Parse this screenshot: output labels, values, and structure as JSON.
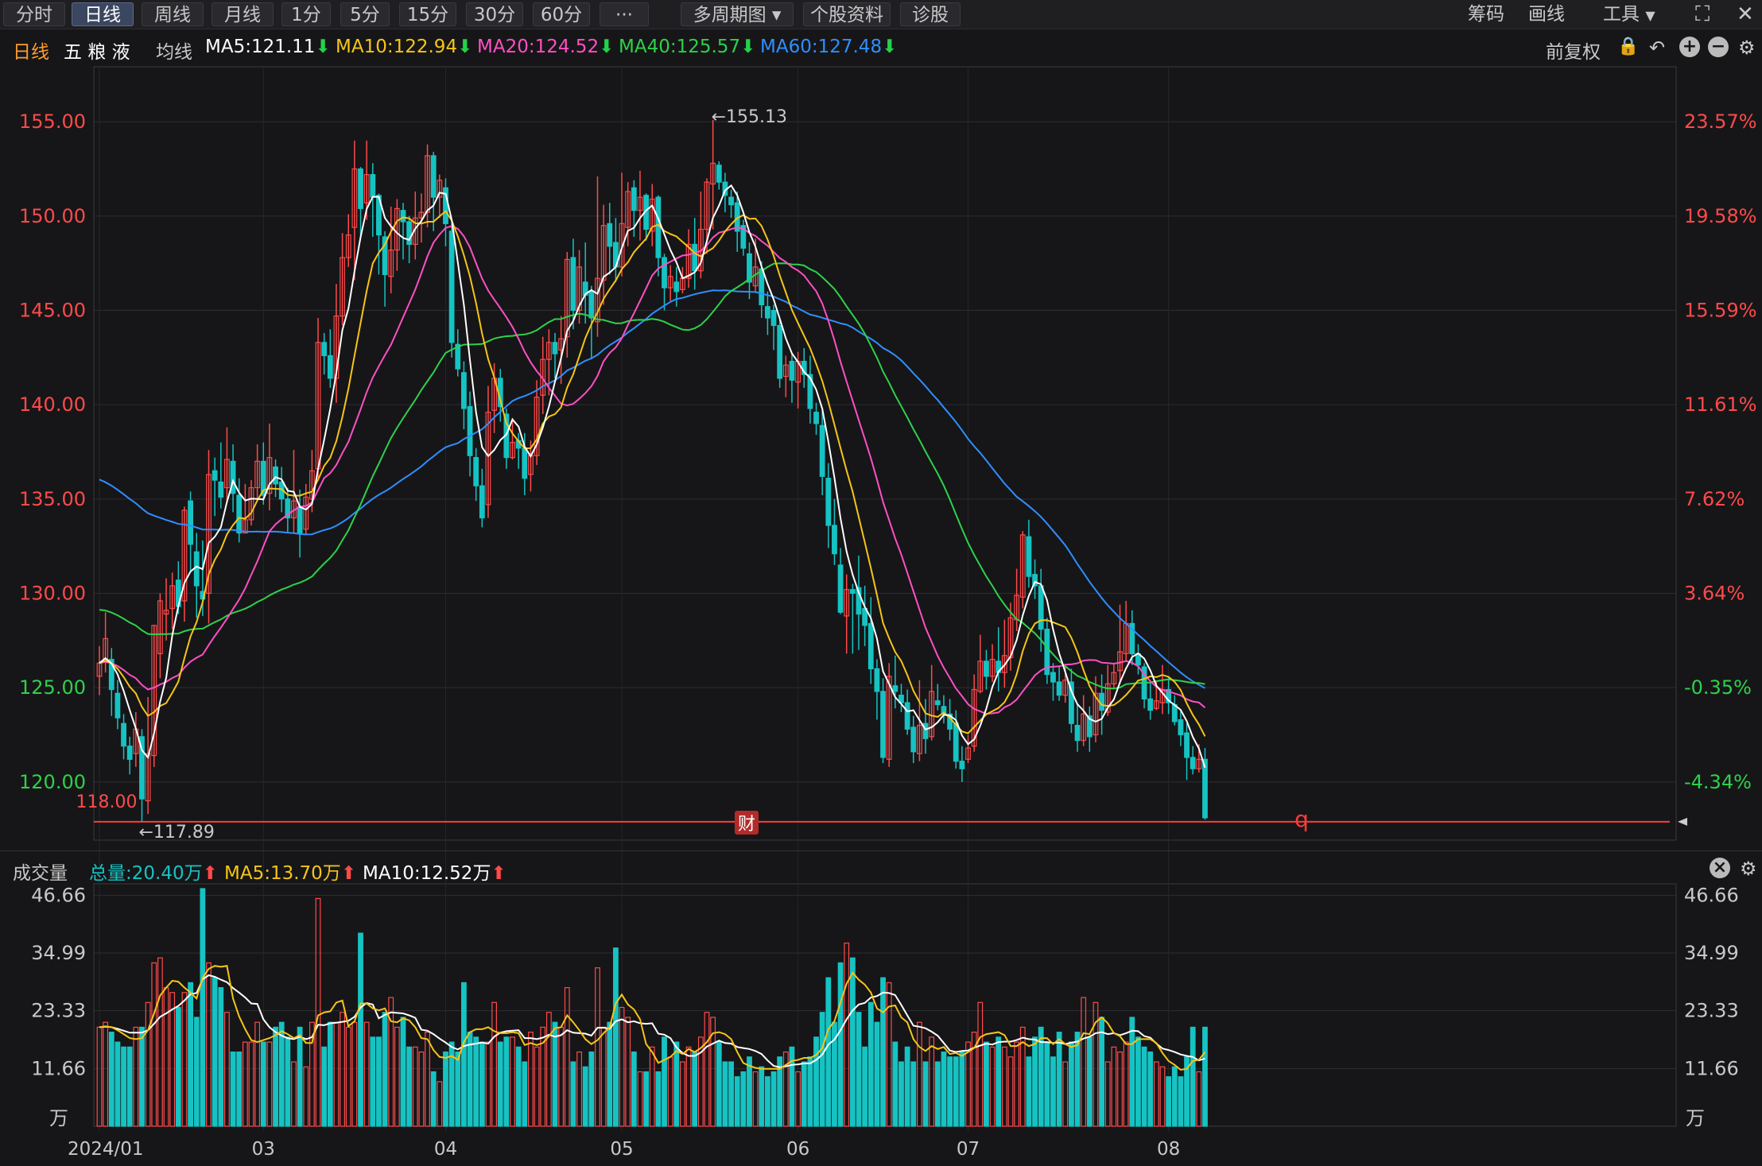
{
  "toolbar": {
    "tabs": [
      "分时",
      "日线",
      "周线",
      "月线",
      "1分",
      "5分",
      "15分",
      "30分",
      "60分",
      "···",
      "多周期图",
      "个股资料",
      "诊股"
    ],
    "active_tab": 1,
    "chip_label": "筹码",
    "draw_label": "画线",
    "tools_label": "工具"
  },
  "info": {
    "period": "日线",
    "stock_name": "五 粮 液",
    "ma_label": "均线",
    "ma5": "MA5:121.11",
    "ma10": "MA10:122.94",
    "ma20": "MA20:124.52",
    "ma40": "MA40:125.57",
    "ma60": "MA60:127.48",
    "adjust": "前复权",
    "down_arrow": "⬇"
  },
  "colors": {
    "up": "#ff4a4a",
    "down": "#16c3c3",
    "ma5": "#ffffff",
    "ma10": "#f5c518",
    "ma20": "#ff4fc4",
    "ma40": "#2ed14a",
    "ma60": "#2f8fff",
    "bg": "#161618",
    "grid": "#2e2e33"
  },
  "volume_bar": {
    "label": "成交量",
    "total": "总量:20.40万",
    "ma5": "MA5:13.70万",
    "ma10": "MA10:12.52万",
    "up_arrow": "⬆"
  },
  "annotations": {
    "high": "←155.13",
    "low": "←117.89",
    "low_ref": "118.00",
    "fin_marker": "财",
    "q_marker": "q"
  },
  "chart_data": {
    "type": "candlestick",
    "price_ylim": [
      117.0,
      158.0
    ],
    "price_ticks": [
      "155.00",
      "150.00",
      "145.00",
      "140.00",
      "135.00",
      "130.00",
      "125.00",
      "120.00"
    ],
    "pct_ticks": [
      "23.57%",
      "19.58%",
      "15.59%",
      "11.61%",
      "7.62%",
      "3.64%",
      "-0.35%",
      "-4.34%"
    ],
    "volume_ylim": [
      0,
      48
    ],
    "volume_ticks": [
      "46.66",
      "34.99",
      "23.33",
      "11.66"
    ],
    "volume_unit": "万",
    "x_ticks": [
      {
        "label": "2024/01",
        "index": 0
      },
      {
        "label": "03",
        "index": 27
      },
      {
        "label": "04",
        "index": 57
      },
      {
        "label": "05",
        "index": 86
      },
      {
        "label": "06",
        "index": 115
      },
      {
        "label": "07",
        "index": 143
      },
      {
        "label": "08",
        "index": 176
      }
    ],
    "ma_periods": [
      5,
      10,
      20,
      40,
      60
    ],
    "ma60_start": 136.2,
    "candles": [
      [
        125.6,
        126.3,
        127.2,
        124.6,
        20
      ],
      [
        126.4,
        127.6,
        129.0,
        125.8,
        21
      ],
      [
        126.5,
        124.9,
        127.1,
        123.5,
        19
      ],
      [
        124.7,
        123.4,
        125.4,
        122.8,
        17
      ],
      [
        123.1,
        121.9,
        123.6,
        121.2,
        16
      ],
      [
        121.9,
        121.2,
        122.4,
        120.4,
        16
      ],
      [
        121.5,
        122.8,
        123.7,
        120.8,
        20
      ],
      [
        122.4,
        119.1,
        122.8,
        117.9,
        20
      ],
      [
        119.0,
        121.5,
        124.5,
        118.3,
        25
      ],
      [
        121.4,
        128.3,
        128.3,
        120.8,
        33
      ],
      [
        126.8,
        129.6,
        130.0,
        125.5,
        34
      ],
      [
        128.9,
        129.1,
        130.8,
        127.5,
        28
      ],
      [
        129.2,
        130.4,
        131.1,
        128.1,
        27
      ],
      [
        130.7,
        129.3,
        131.7,
        128.9,
        24
      ],
      [
        129.6,
        134.4,
        134.6,
        128.5,
        27
      ],
      [
        134.9,
        132.6,
        135.4,
        131.1,
        29
      ],
      [
        132.2,
        130.4,
        133.2,
        128.7,
        22
      ],
      [
        130.1,
        129.7,
        132.8,
        128.8,
        48
      ],
      [
        130.0,
        136.3,
        137.6,
        128.4,
        33
      ],
      [
        136.5,
        136.0,
        137.2,
        134.1,
        30
      ],
      [
        135.9,
        135.1,
        138.0,
        134.5,
        28
      ],
      [
        135.6,
        137.1,
        138.8,
        134.8,
        23
      ],
      [
        137.0,
        135.3,
        137.9,
        134.3,
        15
      ],
      [
        135.2,
        133.2,
        136.1,
        132.7,
        15
      ],
      [
        133.2,
        133.9,
        135.8,
        133.2,
        17
      ],
      [
        133.9,
        135.6,
        136.0,
        133.6,
        17
      ],
      [
        135.6,
        137.0,
        137.9,
        134.9,
        21
      ],
      [
        137.0,
        135.2,
        138.0,
        134.7,
        17
      ],
      [
        135.3,
        137.2,
        139.0,
        134.4,
        17
      ],
      [
        136.7,
        135.8,
        137.1,
        135.1,
        20
      ],
      [
        135.9,
        135.0,
        136.7,
        134.3,
        21
      ],
      [
        135.0,
        134.0,
        135.6,
        133.2,
        18
      ],
      [
        134.0,
        134.9,
        137.6,
        133.2,
        13
      ],
      [
        134.6,
        133.2,
        135.5,
        131.9,
        20
      ],
      [
        133.4,
        135.1,
        135.8,
        133.1,
        12
      ],
      [
        135.0,
        136.5,
        137.6,
        134.3,
        21
      ],
      [
        136.6,
        143.3,
        144.6,
        136.1,
        46
      ],
      [
        143.3,
        142.6,
        143.8,
        141.6,
        16
      ],
      [
        142.6,
        141.4,
        144.0,
        140.9,
        21
      ],
      [
        141.4,
        144.7,
        146.4,
        140.1,
        21
      ],
      [
        144.7,
        147.8,
        149.1,
        144.2,
        23
      ],
      [
        147.8,
        149.0,
        150.1,
        147.3,
        20
      ],
      [
        149.4,
        152.5,
        154.0,
        146.6,
        21
      ],
      [
        152.5,
        150.4,
        152.6,
        148.9,
        39
      ],
      [
        150.7,
        152.2,
        154.0,
        149.8,
        21
      ],
      [
        152.2,
        151.0,
        152.8,
        148.9,
        18
      ],
      [
        151.1,
        149.0,
        151.2,
        146.9,
        18
      ],
      [
        148.9,
        146.9,
        149.2,
        145.2,
        23
      ],
      [
        146.8,
        148.2,
        150.5,
        145.9,
        26
      ],
      [
        148.2,
        150.4,
        150.9,
        147.1,
        20
      ],
      [
        150.3,
        149.7,
        150.7,
        147.7,
        22
      ],
      [
        149.7,
        148.5,
        150.0,
        147.5,
        16
      ],
      [
        148.5,
        149.9,
        151.3,
        147.7,
        16
      ],
      [
        149.9,
        150.2,
        151.2,
        148.6,
        15
      ],
      [
        150.2,
        153.2,
        153.8,
        149.4,
        19
      ],
      [
        153.2,
        151.0,
        153.4,
        149.2,
        11
      ],
      [
        151.0,
        151.9,
        152.2,
        149.9,
        9
      ],
      [
        151.5,
        149.6,
        152.0,
        148.4,
        15
      ],
      [
        149.2,
        143.3,
        149.6,
        142.5,
        17
      ],
      [
        143.2,
        141.9,
        144.0,
        141.5,
        15
      ],
      [
        141.7,
        139.8,
        142.3,
        138.7,
        29
      ],
      [
        139.9,
        137.3,
        140.7,
        136.2,
        19
      ],
      [
        137.2,
        135.7,
        137.7,
        134.9,
        18
      ],
      [
        135.7,
        134.0,
        136.6,
        133.5,
        17
      ],
      [
        134.7,
        139.6,
        141.0,
        134.0,
        17
      ],
      [
        139.7,
        141.4,
        142.2,
        138.5,
        25
      ],
      [
        141.4,
        139.9,
        141.9,
        139.1,
        17
      ],
      [
        139.5,
        137.2,
        139.8,
        136.6,
        18
      ],
      [
        137.2,
        138.0,
        139.3,
        137.1,
        18
      ],
      [
        138.1,
        137.7,
        138.5,
        136.6,
        16
      ],
      [
        137.7,
        136.1,
        138.5,
        135.2,
        13
      ],
      [
        136.3,
        137.3,
        138.1,
        135.4,
        19
      ],
      [
        137.3,
        140.4,
        141.3,
        136.8,
        16
      ],
      [
        140.5,
        142.4,
        143.6,
        139.5,
        20
      ],
      [
        142.4,
        143.3,
        144.0,
        140.5,
        23
      ],
      [
        143.3,
        142.7,
        143.8,
        141.4,
        21
      ],
      [
        142.9,
        143.5,
        144.7,
        141.1,
        20
      ],
      [
        143.6,
        147.7,
        148.1,
        142.5,
        28
      ],
      [
        147.8,
        145.0,
        148.8,
        144.0,
        13
      ],
      [
        145.0,
        147.3,
        148.2,
        144.3,
        15
      ],
      [
        146.5,
        145.8,
        148.6,
        144.3,
        12
      ],
      [
        146.0,
        144.6,
        146.3,
        142.4,
        15
      ],
      [
        144.4,
        146.7,
        152.1,
        143.6,
        32
      ],
      [
        146.6,
        149.5,
        150.6,
        145.3,
        20
      ],
      [
        149.6,
        148.4,
        150.7,
        146.9,
        21
      ],
      [
        148.6,
        147.3,
        149.9,
        146.5,
        36
      ],
      [
        147.3,
        149.6,
        152.3,
        146.8,
        24
      ],
      [
        149.4,
        151.3,
        151.8,
        148.4,
        22
      ],
      [
        151.5,
        150.3,
        151.9,
        148.9,
        15
      ],
      [
        150.3,
        151.0,
        152.4,
        148.7,
        11
      ],
      [
        151.1,
        149.3,
        151.2,
        148.7,
        11
      ],
      [
        149.2,
        150.9,
        151.7,
        148.4,
        16
      ],
      [
        151.0,
        147.8,
        151.1,
        146.8,
        11
      ],
      [
        147.8,
        146.2,
        148.0,
        145.0,
        18
      ],
      [
        146.2,
        146.8,
        147.4,
        145.5,
        14
      ],
      [
        146.5,
        146.0,
        147.3,
        145.2,
        17
      ],
      [
        146.1,
        146.7,
        147.3,
        145.9,
        13
      ],
      [
        146.7,
        148.5,
        149.3,
        146.2,
        16
      ],
      [
        148.5,
        147.1,
        149.9,
        146.1,
        15
      ],
      [
        147.1,
        149.3,
        151.3,
        146.7,
        18
      ],
      [
        149.3,
        151.8,
        152.0,
        148.0,
        23
      ],
      [
        151.7,
        152.8,
        155.1,
        149.3,
        22
      ],
      [
        152.7,
        151.8,
        152.9,
        151.4,
        17
      ],
      [
        151.8,
        151.1,
        152.3,
        150.2,
        13
      ],
      [
        151.0,
        150.6,
        151.4,
        149.9,
        13
      ],
      [
        150.7,
        149.2,
        151.3,
        148.1,
        10
      ],
      [
        149.5,
        148.3,
        149.8,
        147.9,
        11
      ],
      [
        148.0,
        146.5,
        148.6,
        145.6,
        14
      ],
      [
        146.3,
        147.3,
        148.8,
        146.0,
        11
      ],
      [
        147.2,
        145.3,
        147.6,
        144.6,
        12
      ],
      [
        145.2,
        144.6,
        146.0,
        143.7,
        10
      ],
      [
        145.0,
        144.2,
        145.3,
        142.9,
        11
      ],
      [
        144.2,
        141.4,
        144.5,
        140.9,
        14
      ],
      [
        141.5,
        142.1,
        142.6,
        140.4,
        15
      ],
      [
        142.3,
        141.3,
        142.7,
        140.1,
        16
      ],
      [
        141.2,
        142.3,
        142.8,
        139.8,
        11
      ],
      [
        142.3,
        141.6,
        143.0,
        140.9,
        13
      ],
      [
        141.6,
        139.8,
        142.6,
        139.0,
        14
      ],
      [
        139.6,
        139.0,
        140.1,
        138.4,
        18
      ],
      [
        138.9,
        136.2,
        139.7,
        135.2,
        23
      ],
      [
        136.1,
        133.6,
        136.9,
        132.4,
        30
      ],
      [
        133.6,
        132.1,
        135.0,
        131.5,
        21
      ],
      [
        131.5,
        129.0,
        132.4,
        128.9,
        33
      ],
      [
        128.8,
        130.2,
        131.0,
        126.8,
        37
      ],
      [
        130.2,
        130.0,
        130.5,
        126.8,
        34
      ],
      [
        130.3,
        128.9,
        132.0,
        127.0,
        23
      ],
      [
        129.2,
        128.3,
        130.4,
        127.2,
        16
      ],
      [
        128.4,
        126.0,
        129.8,
        125.2,
        25
      ],
      [
        126.0,
        124.8,
        126.5,
        123.3,
        21
      ],
      [
        124.8,
        121.3,
        125.5,
        121.0,
        30
      ],
      [
        121.2,
        125.6,
        126.3,
        120.8,
        29
      ],
      [
        125.1,
        124.8,
        126.7,
        123.9,
        17
      ],
      [
        124.6,
        124.2,
        125.2,
        123.7,
        13
      ],
      [
        124.2,
        122.8,
        124.9,
        122.5,
        16
      ],
      [
        122.9,
        121.6,
        123.5,
        121.0,
        13
      ],
      [
        121.5,
        123.0,
        125.4,
        121.1,
        21
      ],
      [
        123.1,
        122.3,
        124.4,
        121.5,
        13
      ],
      [
        122.4,
        124.8,
        126.2,
        122.2,
        18
      ],
      [
        124.3,
        124.1,
        125.2,
        123.8,
        13
      ],
      [
        124.0,
        123.6,
        124.6,
        123.1,
        15
      ],
      [
        123.6,
        122.8,
        124.4,
        122.2,
        14
      ],
      [
        123.1,
        121.1,
        123.8,
        120.7,
        14
      ],
      [
        121.1,
        120.7,
        121.9,
        120.0,
        15
      ],
      [
        121.2,
        121.8,
        122.5,
        121.0,
        17
      ],
      [
        121.9,
        124.9,
        125.7,
        121.6,
        19
      ],
      [
        124.8,
        126.4,
        127.8,
        124.7,
        25
      ],
      [
        126.4,
        125.6,
        127.0,
        124.9,
        17
      ],
      [
        125.6,
        126.5,
        127.3,
        125.3,
        16
      ],
      [
        126.4,
        125.8,
        128.2,
        124.8,
        18
      ],
      [
        125.8,
        126.7,
        128.6,
        125.0,
        16
      ],
      [
        126.6,
        128.7,
        129.5,
        125.9,
        14
      ],
      [
        128.6,
        129.9,
        131.3,
        128.0,
        17
      ],
      [
        129.8,
        133.1,
        133.3,
        129.2,
        20
      ],
      [
        133.0,
        130.9,
        133.9,
        130.3,
        14
      ],
      [
        131.0,
        130.4,
        131.8,
        129.7,
        18
      ],
      [
        130.4,
        128.1,
        131.3,
        126.9,
        20
      ],
      [
        128.1,
        125.7,
        128.7,
        125.2,
        17
      ],
      [
        125.8,
        125.3,
        126.3,
        124.3,
        14
      ],
      [
        125.3,
        124.6,
        126.1,
        124.3,
        19
      ],
      [
        124.6,
        125.4,
        126.2,
        124.2,
        13
      ],
      [
        125.3,
        123.1,
        126.0,
        122.6,
        17
      ],
      [
        123.0,
        122.2,
        124.1,
        121.6,
        19
      ],
      [
        122.2,
        123.6,
        124.6,
        121.9,
        26
      ],
      [
        123.5,
        122.4,
        124.0,
        121.6,
        18
      ],
      [
        122.5,
        124.7,
        125.6,
        122.1,
        25
      ],
      [
        124.7,
        123.8,
        125.7,
        122.5,
        22
      ],
      [
        123.7,
        125.2,
        126.2,
        123.5,
        13
      ],
      [
        125.2,
        125.8,
        126.3,
        125.0,
        16
      ],
      [
        125.9,
        126.9,
        129.4,
        125.2,
        15
      ],
      [
        126.8,
        128.4,
        129.6,
        126.4,
        17
      ],
      [
        128.4,
        126.8,
        129.1,
        126.2,
        22
      ],
      [
        126.8,
        126.2,
        127.3,
        125.7,
        18
      ],
      [
        126.1,
        124.4,
        126.3,
        123.9,
        16
      ],
      [
        124.4,
        123.8,
        125.3,
        123.3,
        15
      ],
      [
        123.9,
        124.3,
        125.3,
        123.8,
        13
      ],
      [
        124.2,
        124.9,
        126.2,
        123.6,
        12
      ],
      [
        124.9,
        124.2,
        125.6,
        123.6,
        10
      ],
      [
        124.1,
        123.2,
        124.6,
        123.0,
        12
      ],
      [
        123.3,
        122.5,
        123.8,
        121.9,
        10
      ],
      [
        122.6,
        121.3,
        123.1,
        120.1,
        14
      ],
      [
        121.3,
        120.7,
        121.9,
        120.4,
        20
      ],
      [
        120.7,
        121.2,
        122.0,
        120.5,
        11
      ],
      [
        121.2,
        118.1,
        121.8,
        118.0,
        20
      ]
    ]
  }
}
